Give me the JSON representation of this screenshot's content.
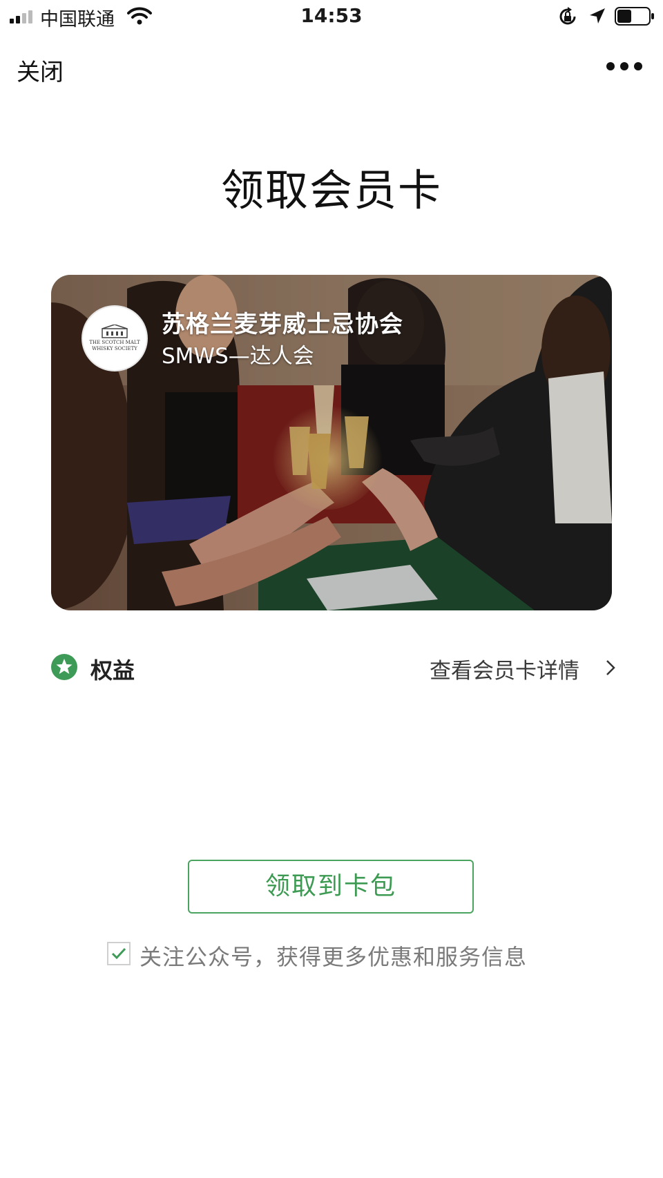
{
  "status_bar": {
    "carrier": "中国联通",
    "time": "14:53",
    "icons": [
      "signal-icon",
      "wifi-icon",
      "rotation-lock-icon",
      "location-arrow-icon",
      "battery-icon"
    ],
    "battery_level": 0.45
  },
  "nav": {
    "close_label": "关闭",
    "more_icon": "more-dots-icon"
  },
  "page": {
    "title": "领取会员卡"
  },
  "card": {
    "brand_name": "苏格兰麦芽威士忌协会",
    "subtitle": "SMWS—达人会",
    "logo_text": "THE SCOTCH MALT WHISKY SOCIETY"
  },
  "benefits": {
    "icon": "star-icon",
    "label": "权益",
    "details_link": "查看会员卡详情",
    "chevron_icon": "chevron-right-icon"
  },
  "actions": {
    "claim_button": "领取到卡包",
    "follow_checked": true,
    "follow_text": "关注公众号，获得更多优惠和服务信息"
  },
  "colors": {
    "accent_green": "#4aa35e",
    "star_green": "#3e9a57"
  }
}
